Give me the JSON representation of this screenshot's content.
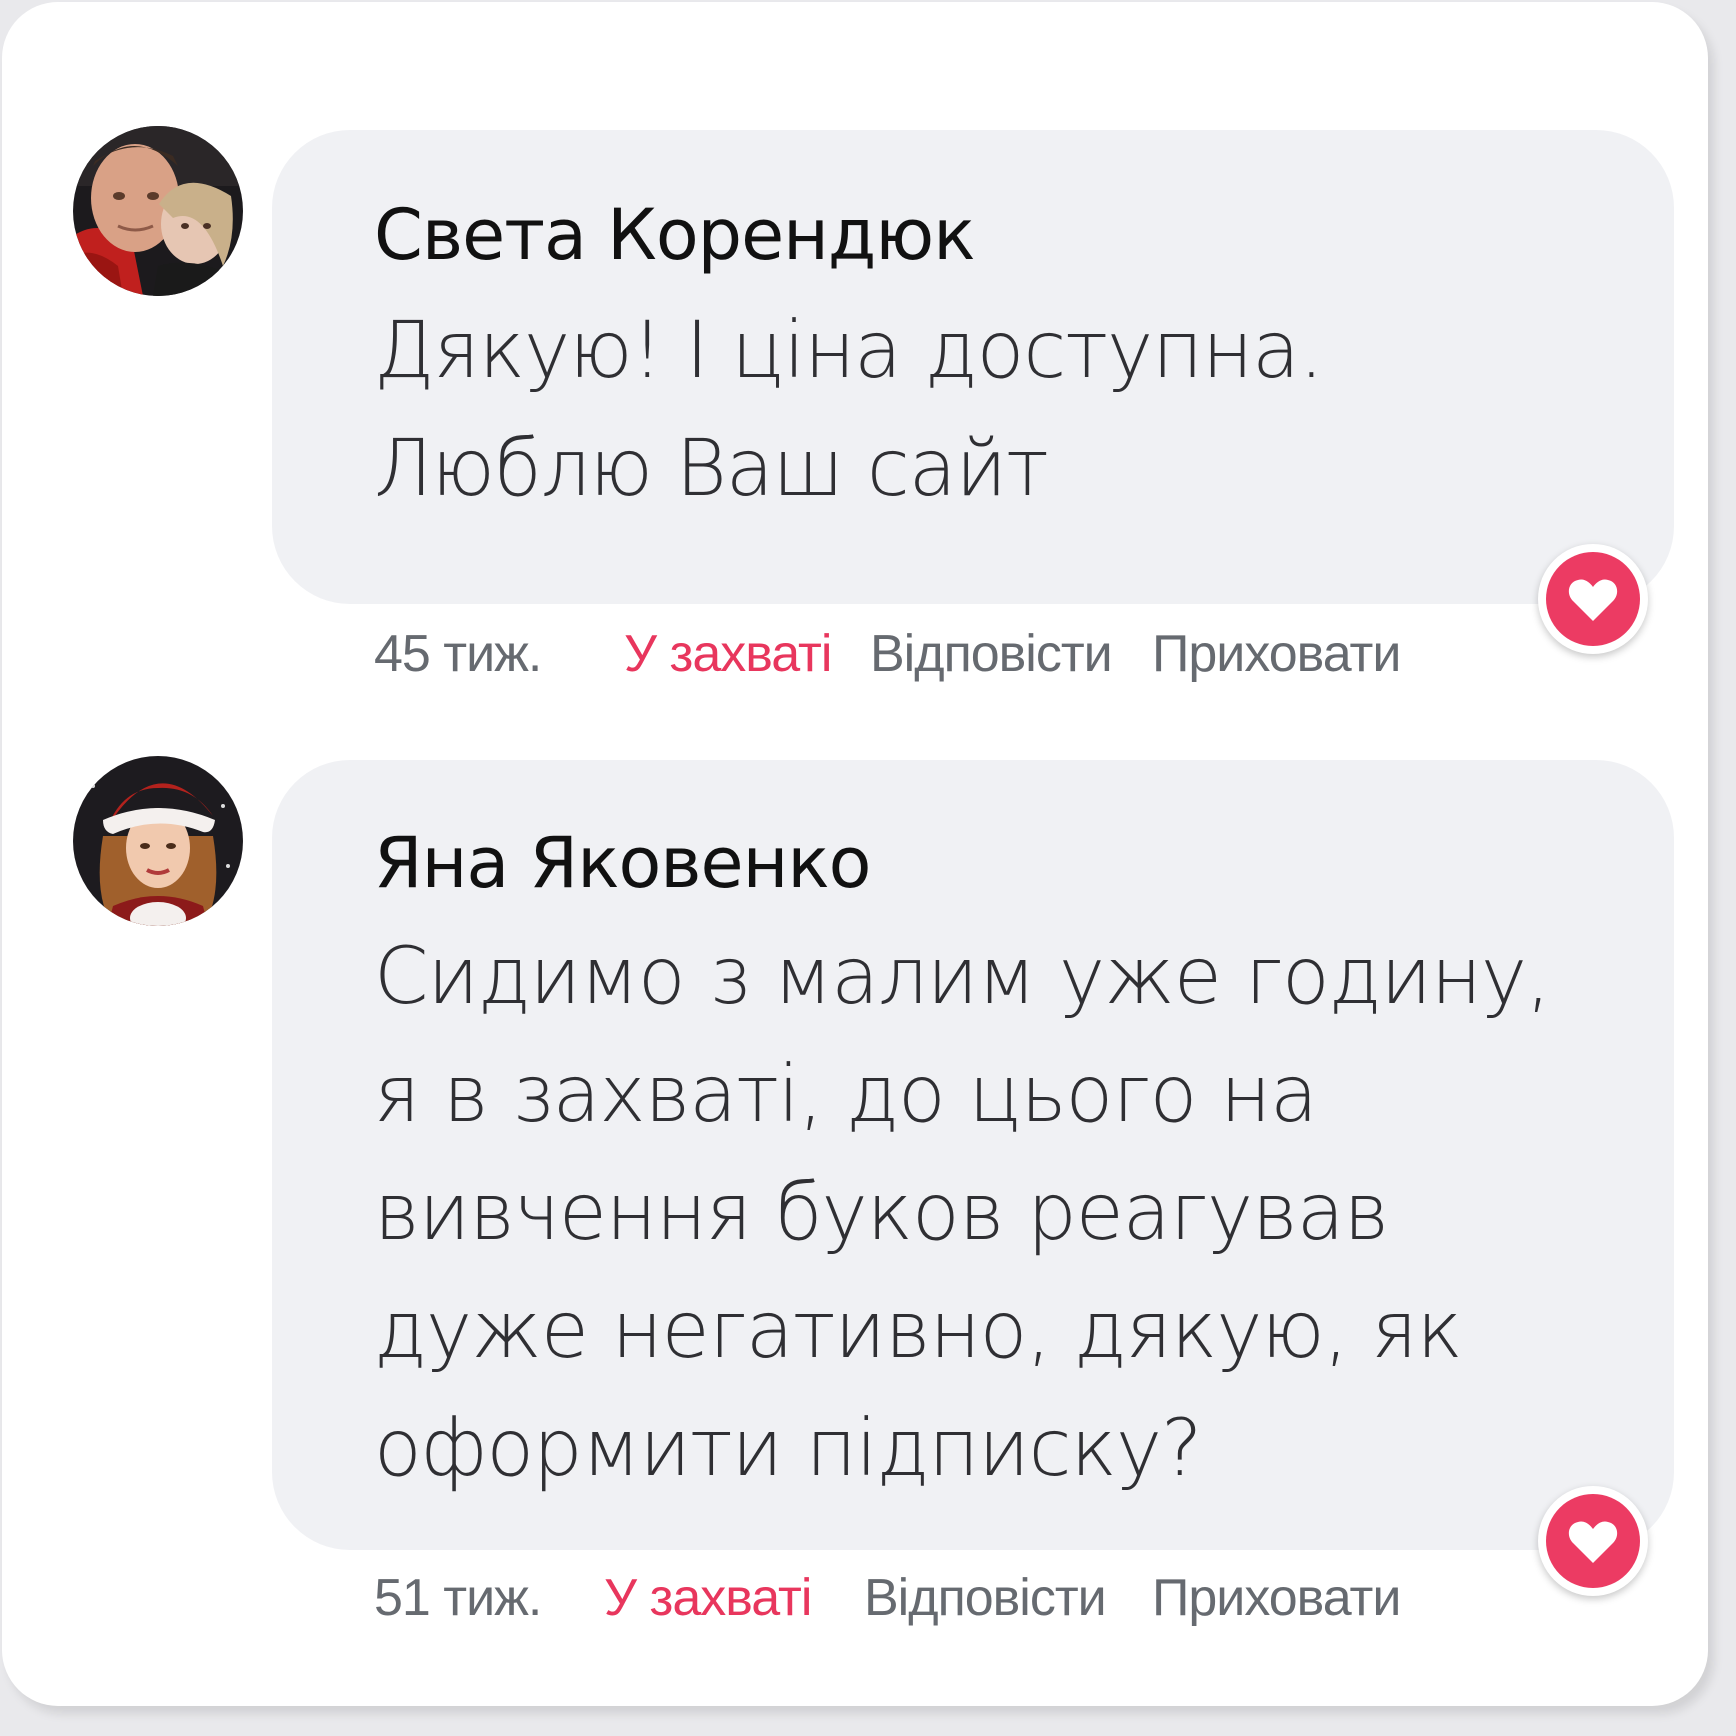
{
  "colors": {
    "like_accent": "#e8365d",
    "heart_badge": "#ec3b63",
    "bubble_bg": "#f0f1f4",
    "meta_text": "#666a70"
  },
  "comments": [
    {
      "author": "Света Корендюк",
      "text": "Дякую! І ціна доступна.\nЛюблю Ваш сайт",
      "time": "45 тиж.",
      "like_label": "У захваті",
      "reply_label": "Відповісти",
      "hide_label": "Приховати",
      "avatar_icon": "couple-photo-avatar",
      "reaction_icon": "heart-icon"
    },
    {
      "author": "Яна Яковенко",
      "text": "Сидимо з малим уже годину,\nя в захваті, до цього на\nвивчення буков реагував\nдуже негативно, дякую, як\nоформити підписку?",
      "time": "51 тиж.",
      "like_label": "У захваті",
      "reply_label": "Відповісти",
      "hide_label": "Приховати",
      "avatar_icon": "woman-santa-hat-avatar",
      "reaction_icon": "heart-icon"
    }
  ]
}
